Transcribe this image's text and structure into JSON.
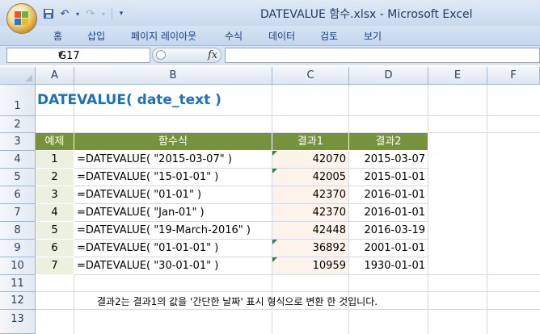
{
  "window": {
    "title": "DATEVALUE 함수.xlsx  -  Microsoft Excel"
  },
  "ribbon": {
    "tabs": [
      "홈",
      "삽입",
      "페이지 레이아웃",
      "수식",
      "데이터",
      "검토",
      "보기"
    ]
  },
  "formula_bar": {
    "name_box": "G17",
    "fx_label": "fx",
    "formula": ""
  },
  "columns": [
    "A",
    "B",
    "C",
    "D",
    "E",
    "F"
  ],
  "rows": [
    "1",
    "2",
    "3",
    "4",
    "5",
    "6",
    "7",
    "8",
    "9",
    "10",
    "11",
    "12",
    "13"
  ],
  "sheet": {
    "title": "DATEVALUE( date_text )",
    "headers": [
      "예제",
      "함수식",
      "결과1",
      "결과2"
    ],
    "data": [
      {
        "no": "1",
        "formula": "=DATEVALUE( \"2015-03-07\" )",
        "result1": "42070",
        "result2": "2015-03-07"
      },
      {
        "no": "2",
        "formula": "=DATEVALUE( \"15-01-01\" )",
        "result1": "42005",
        "result2": "2015-01-01"
      },
      {
        "no": "3",
        "formula": "=DATEVALUE( \"01-01\" )",
        "result1": "42370",
        "result2": "2016-01-01"
      },
      {
        "no": "4",
        "formula": "=DATEVALUE( \"Jan-01\" )",
        "result1": "42370",
        "result2": "2016-01-01"
      },
      {
        "no": "5",
        "formula": "=DATEVALUE( \"19-March-2016\" )",
        "result1": "42448",
        "result2": "2016-03-19"
      },
      {
        "no": "6",
        "formula": "=DATEVALUE( \"01-01-01\" )",
        "result1": "36892",
        "result2": "2001-01-01"
      },
      {
        "no": "7",
        "formula": "=DATEVALUE( \"30-01-01\" )",
        "result1": "10959",
        "result2": "1930-01-01"
      }
    ],
    "note": "결과2는 결과1의 값을 '간단한 날짜' 표시 형식으로 변환 한 것입니다."
  },
  "colors": {
    "header_green": "#76923c",
    "light_green": "#ebf1de",
    "light_peach": "#fdf3ea",
    "title_blue": "#1f70b8"
  }
}
